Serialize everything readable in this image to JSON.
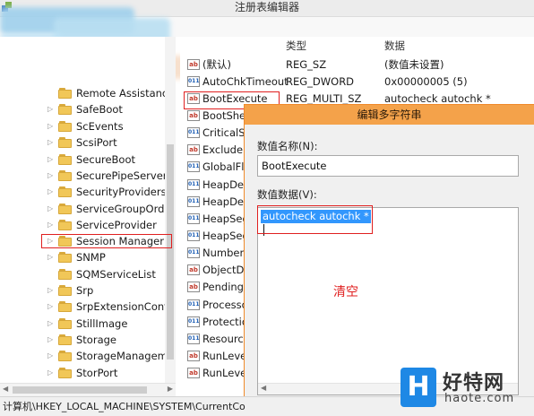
{
  "window": {
    "title": "注册表编辑器"
  },
  "tree": {
    "items": [
      {
        "label": "Remote Assistance",
        "arrow": ""
      },
      {
        "label": "SafeBoot",
        "arrow": "▷"
      },
      {
        "label": "ScEvents",
        "arrow": "▷"
      },
      {
        "label": "ScsiPort",
        "arrow": "▷"
      },
      {
        "label": "SecureBoot",
        "arrow": "▷"
      },
      {
        "label": "SecurePipeServers",
        "arrow": "▷"
      },
      {
        "label": "SecurityProviders",
        "arrow": "▷"
      },
      {
        "label": "ServiceGroupOrder",
        "arrow": "▷"
      },
      {
        "label": "ServiceProvider",
        "arrow": "▷"
      },
      {
        "label": "Session Manager",
        "arrow": "▷"
      },
      {
        "label": "SNMP",
        "arrow": "▷"
      },
      {
        "label": "SQMServiceList",
        "arrow": ""
      },
      {
        "label": "Srp",
        "arrow": "▷"
      },
      {
        "label": "SrpExtensionConfig",
        "arrow": "▷"
      },
      {
        "label": "StillImage",
        "arrow": "▷"
      },
      {
        "label": "Storage",
        "arrow": "▷"
      },
      {
        "label": "StorageManagement",
        "arrow": "▷"
      },
      {
        "label": "StorPort",
        "arrow": "▷"
      }
    ]
  },
  "values_pane": {
    "columns": {
      "type": "类型",
      "data": "数据"
    },
    "rows": [
      {
        "name": "(默认)",
        "icon": "ab",
        "type": "REG_SZ",
        "data": "(数值未设置)"
      },
      {
        "name": "AutoChkTimeout",
        "icon": "bin",
        "type": "REG_DWORD",
        "data": "0x00000005 (5)"
      },
      {
        "name": "BootExecute",
        "icon": "ab",
        "type": "REG_MULTI_SZ",
        "data": "autocheck autochk *"
      },
      {
        "name": "BootShell",
        "icon": "ab",
        "type": "",
        "data": ""
      },
      {
        "name": "CriticalSectionTimeout",
        "icon": "bin",
        "type": "",
        "data": ""
      },
      {
        "name": "ExcludeFromKnownDlls",
        "icon": "ab",
        "type": "",
        "data": ""
      },
      {
        "name": "GlobalFlag",
        "icon": "bin",
        "type": "",
        "data": ""
      },
      {
        "name": "HeapDeCommitFreeBlockThreshold",
        "icon": "bin",
        "type": "",
        "data": ""
      },
      {
        "name": "HeapDeCommitTotalFreeThreshold",
        "icon": "bin",
        "type": "",
        "data": ""
      },
      {
        "name": "HeapSegmentCommit",
        "icon": "bin",
        "type": "",
        "data": ""
      },
      {
        "name": "HeapSegmentReserve",
        "icon": "bin",
        "type": "",
        "data": ""
      },
      {
        "name": "NumberOfInitialSessions",
        "icon": "bin",
        "type": "",
        "data": ""
      },
      {
        "name": "ObjectDirectories",
        "icon": "ab",
        "type": "",
        "data": ""
      },
      {
        "name": "PendingFileRenameOperations",
        "icon": "ab",
        "type": "",
        "data": ""
      },
      {
        "name": "ProcessorControl",
        "icon": "bin",
        "type": "",
        "data": ""
      },
      {
        "name": "ProtectionMode",
        "icon": "bin",
        "type": "",
        "data": ""
      },
      {
        "name": "ResourceTimeoutCount",
        "icon": "bin",
        "type": "",
        "data": ""
      },
      {
        "name": "RunLevelExecute",
        "icon": "ab",
        "type": "",
        "data": ""
      },
      {
        "name": "RunLevelValidate",
        "icon": "ab",
        "type": "",
        "data": ""
      }
    ]
  },
  "status_bar": {
    "path": "计算机\\HKEY_LOCAL_MACHINE\\SYSTEM\\CurrentCo"
  },
  "dialog": {
    "title": "编辑多字符串",
    "name_label": "数值名称(N):",
    "name_value": "BootExecute",
    "data_label": "数值数据(V):",
    "data_value": "autocheck autochk *",
    "annotation": "清空"
  },
  "watermark": {
    "logo_letter": "H",
    "name": "好特网",
    "url": "haote.com"
  },
  "colors": {
    "dialog_title_bg": "#f4a24a",
    "selection": "#3297fd",
    "highlight_box": "#e02020",
    "watermark_logo": "#1e88e5"
  }
}
